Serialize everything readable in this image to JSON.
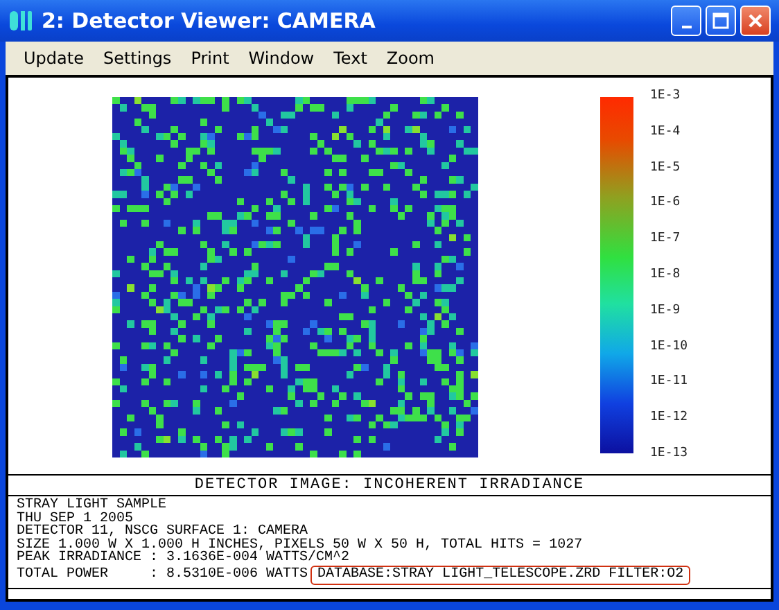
{
  "window": {
    "title": "2: Detector Viewer: CAMERA"
  },
  "menu": [
    "Update",
    "Settings",
    "Print",
    "Window",
    "Text",
    "Zoom"
  ],
  "colorbar": {
    "labels": [
      "1E-3",
      "1E-4",
      "1E-5",
      "1E-6",
      "1E-7",
      "1E-8",
      "1E-9",
      "1E-10",
      "1E-11",
      "1E-12",
      "1E-13"
    ]
  },
  "caption": "DETECTOR IMAGE: INCOHERENT IRRADIANCE",
  "info_lines": [
    "STRAY LIGHT SAMPLE",
    "THU SEP 1 2005",
    "DETECTOR 11, NSCG SURFACE 1: CAMERA",
    "SIZE 1.000 W X 1.000 H INCHES, PIXELS 50 W X 50 H, TOTAL HITS = 1027",
    "PEAK IRRADIANCE : 3.1636E-004 WATTS/CM^2",
    "TOTAL POWER     : 8.5310E-006 WATTS"
  ],
  "highlighted_note": "DATABASE:STRAY LIGHT_TELESCOPE.ZRD FILTER:O2"
}
